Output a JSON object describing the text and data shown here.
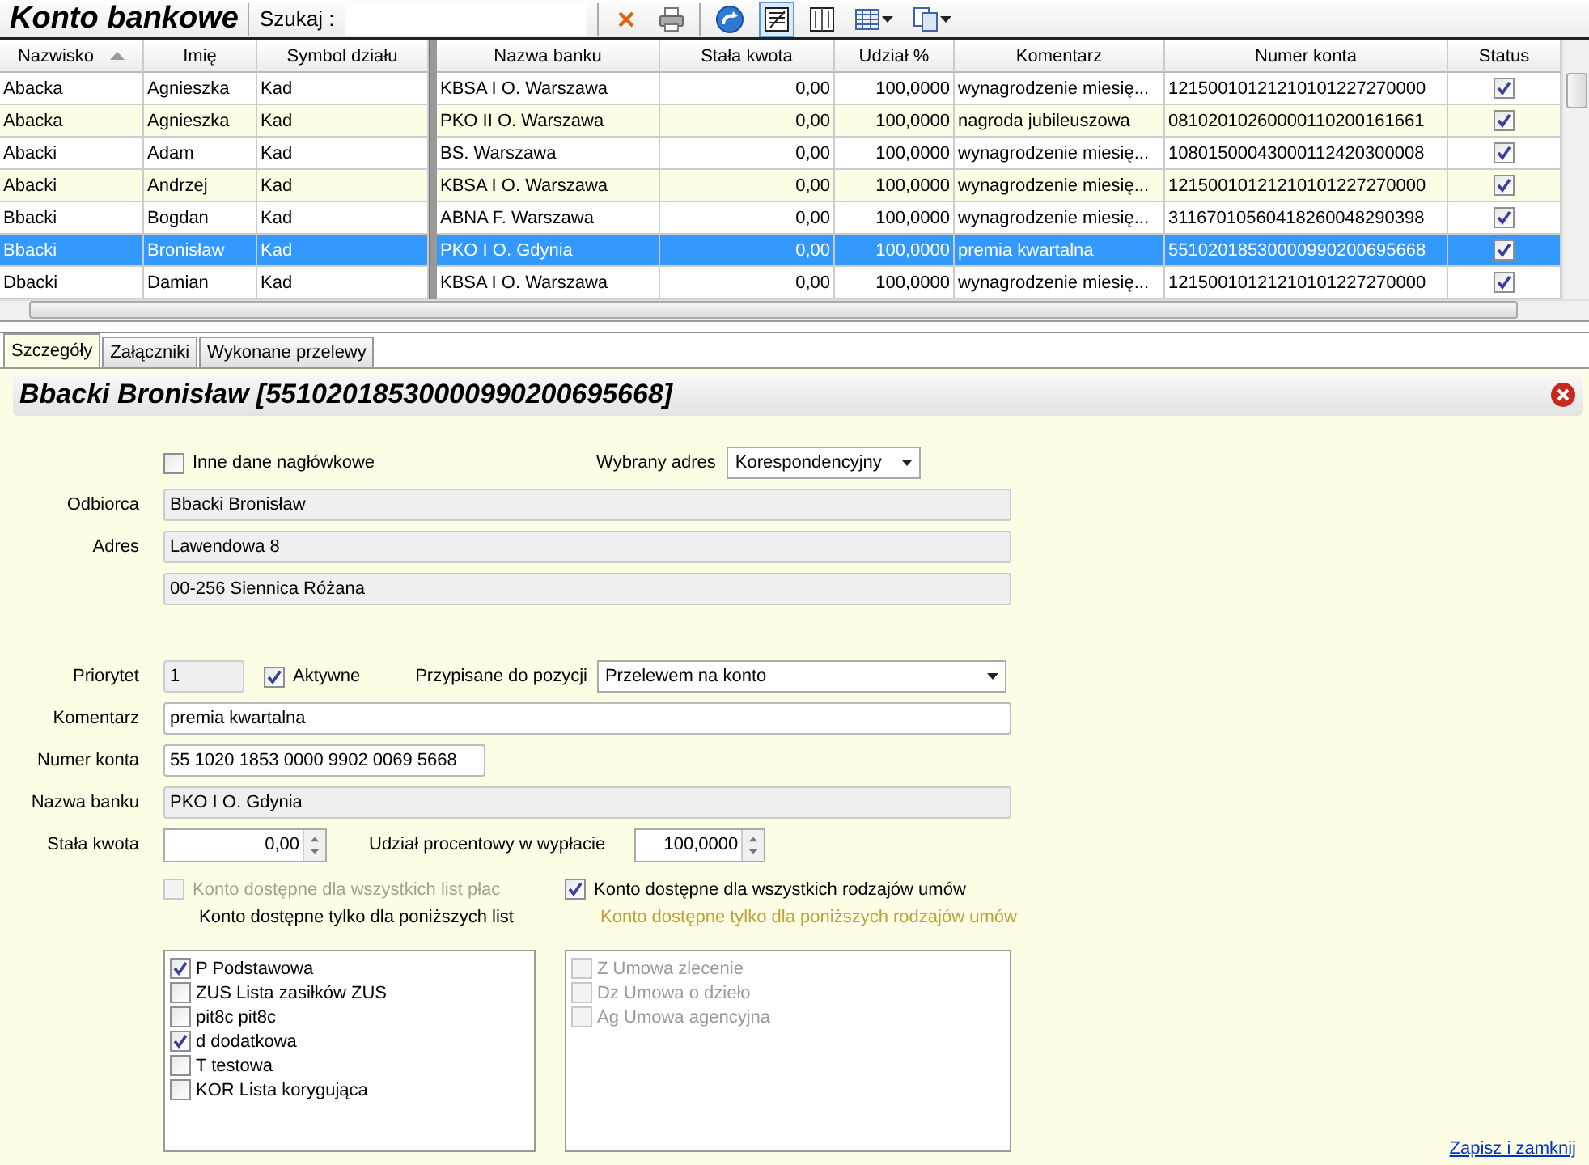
{
  "toolbar": {
    "title": "Konto bankowe",
    "search_label": "Szukaj :"
  },
  "table": {
    "columns": [
      {
        "label": "Nazwisko",
        "sorted": true
      },
      {
        "label": "Imię",
        "sorted": false
      },
      {
        "label": "Symbol działu",
        "sorted": false
      },
      {
        "label": "Nazwa banku",
        "sorted": false
      },
      {
        "label": "Stała kwota",
        "sorted": false
      },
      {
        "label": "Udział %",
        "sorted": false
      },
      {
        "label": "Komentarz",
        "sorted": false
      },
      {
        "label": "Numer konta",
        "sorted": false
      },
      {
        "label": "Status",
        "sorted": false
      }
    ],
    "rows": [
      {
        "cells": [
          "Abacka",
          "Agnieszka",
          "Kad",
          "KBSA I O. Warszawa",
          "0,00",
          "100,0000",
          "wynagrodzenie miesię...",
          "12150010121210101227270000"
        ],
        "status": true,
        "selected": false
      },
      {
        "cells": [
          "Abacka",
          "Agnieszka",
          "Kad",
          "PKO II O. Warszawa",
          "0,00",
          "100,0000",
          "nagroda jubileuszowa",
          "08102010260000110200161661"
        ],
        "status": true,
        "selected": false
      },
      {
        "cells": [
          "Abacki",
          "Adam",
          "Kad",
          "BS. Warszawa",
          "0,00",
          "100,0000",
          "wynagrodzenie miesię...",
          "10801500043000112420300008"
        ],
        "status": true,
        "selected": false
      },
      {
        "cells": [
          "Abacki",
          "Andrzej",
          "Kad",
          "KBSA I O. Warszawa",
          "0,00",
          "100,0000",
          "wynagrodzenie miesię...",
          "12150010121210101227270000"
        ],
        "status": true,
        "selected": false
      },
      {
        "cells": [
          "Bbacki",
          "Bogdan",
          "Kad",
          "ABNA F. Warszawa",
          "0,00",
          "100,0000",
          "wynagrodzenie miesię...",
          "31167010560418260048290398"
        ],
        "status": true,
        "selected": false
      },
      {
        "cells": [
          "Bbacki",
          "Bronisław",
          "Kad",
          "PKO I O. Gdynia",
          "0,00",
          "100,0000",
          "premia kwartalna",
          "55102018530000990200695668"
        ],
        "status": true,
        "selected": true
      },
      {
        "cells": [
          "Dbacki",
          "Damian",
          "Kad",
          "KBSA I O. Warszawa",
          "0,00",
          "100,0000",
          "wynagrodzenie miesię...",
          "12150010121210101227270000"
        ],
        "status": true,
        "selected": false
      }
    ]
  },
  "tabs": [
    {
      "label": "Szczegóły",
      "selected": true
    },
    {
      "label": "Załączniki",
      "selected": false
    },
    {
      "label": "Wykonane przelewy",
      "selected": false
    }
  ],
  "detail": {
    "title": "Bbacki Bronisław [55102018530000990200695668]",
    "other_header": {
      "label": "Inne dane nagłówkowe",
      "checked": false
    },
    "address_choice": {
      "label": "Wybrany adres",
      "value": "Korespondencyjny"
    },
    "recipient": {
      "label": "Odbiorca",
      "value": "Bbacki Bronisław"
    },
    "address": {
      "label": "Adres",
      "line_1": "Lawendowa 8",
      "line_2": "00-256 Siennica Różana"
    },
    "priority": {
      "label": "Priorytet",
      "value": "1"
    },
    "active": {
      "label": "Aktywne",
      "checked": true
    },
    "position": {
      "label": "Przypisane do pozycji",
      "value": "Przelewem na konto"
    },
    "comment": {
      "label": "Komentarz",
      "value": "premia kwartalna"
    },
    "account_number": {
      "label": "Numer konta",
      "value": "55 1020 1853 0000 9902 0069 5668"
    },
    "bank_name": {
      "label": "Nazwa banku",
      "value": "PKO I O. Gdynia"
    },
    "fixed_amount": {
      "label": "Stała kwota",
      "value": "0,00"
    },
    "percent": {
      "label": "Udział procentowy w wypłacie",
      "value": "100,0000"
    },
    "all_payrolls": {
      "label": "Konto dostępne dla wszystkich list płac",
      "checked": false,
      "disabled": true
    },
    "payrolls_caption": {
      "text": "Konto dostępne tylko dla poniższych list",
      "disabled": false
    },
    "payrolls": [
      {
        "label": "P Podstawowa",
        "checked": true,
        "disabled": false
      },
      {
        "label": "ZUS Lista zasiłków ZUS",
        "checked": false,
        "disabled": false
      },
      {
        "label": "pit8c pit8c",
        "checked": false,
        "disabled": false
      },
      {
        "label": "d dodatkowa",
        "checked": true,
        "disabled": false
      },
      {
        "label": "T testowa",
        "checked": false,
        "disabled": false
      },
      {
        "label": "KOR Lista korygująca",
        "checked": false,
        "disabled": false
      }
    ],
    "all_contracts": {
      "label": "Konto dostępne dla wszystkich rodzajów umów",
      "checked": true,
      "disabled": false
    },
    "contracts_caption": {
      "text": "Konto dostępne tylko dla poniższych rodzajów umów",
      "disabled": true
    },
    "contracts": [
      {
        "label": "Z Umowa zlecenie",
        "checked": false,
        "disabled": true
      },
      {
        "label": "Dz Umowa o dzieło",
        "checked": false,
        "disabled": true
      },
      {
        "label": "Ag Umowa agencyjna",
        "checked": false,
        "disabled": true
      }
    ],
    "save_link": "Zapisz i zamknij"
  }
}
